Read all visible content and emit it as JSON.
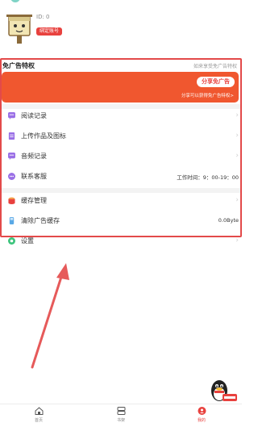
{
  "profile": {
    "id_text": "ID: 0",
    "bind_label": "绑定账号"
  },
  "promo": {
    "title": "免广告特权",
    "subtitle": "如来享受免广告特权",
    "share_button": "分享免广告",
    "share_note": "分享可以获得免广告特权>"
  },
  "menu_group1": [
    {
      "label": "阅读记录",
      "icon": "chat-bubble-icon"
    },
    {
      "label": "上传作品及图标",
      "icon": "document-icon"
    },
    {
      "label": "音频记录",
      "icon": "chat-bubble-icon"
    },
    {
      "label": "联系客服",
      "icon": "support-icon",
      "value": "工作时间：9：00-19：00"
    }
  ],
  "menu_group2": [
    {
      "label": "缓存管理",
      "icon": "cache-icon"
    },
    {
      "label": "清除广告缓存",
      "icon": "clear-cache-icon",
      "value": "0.0Byte"
    },
    {
      "label": "设置",
      "icon": "settings-icon"
    }
  ],
  "tabbar": {
    "items": [
      {
        "label": "首页",
        "icon": "home-icon"
      },
      {
        "label": "书架",
        "icon": "bookshelf-icon"
      },
      {
        "label": "我的",
        "icon": "profile-icon",
        "active": true
      }
    ]
  },
  "colors": {
    "accent": "#e8413e",
    "promo_card": "#f0572f",
    "highlight": "#e34a4a",
    "menu_icon": "#9a6fe6"
  }
}
